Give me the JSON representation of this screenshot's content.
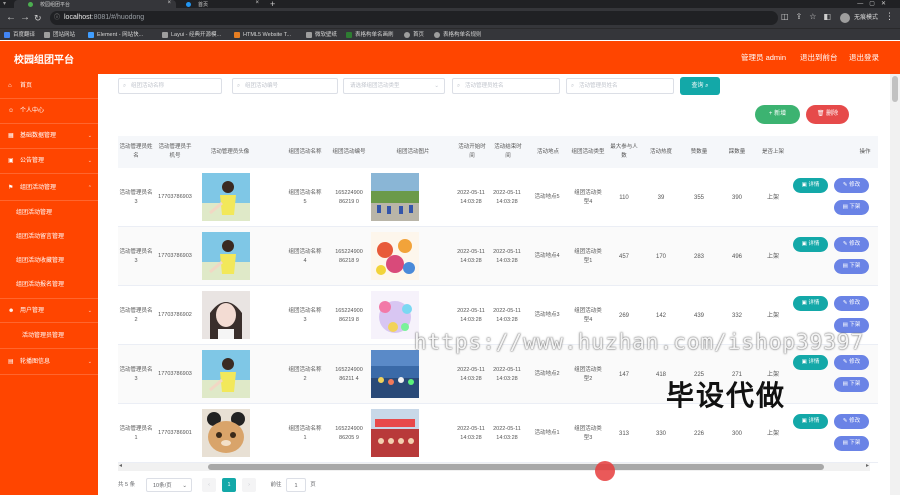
{
  "browser": {
    "tabs": [
      {
        "title": "校园组团平台"
      },
      {
        "title": "首页"
      }
    ],
    "new_tab": "+",
    "url_host": "localhost",
    "url_path": ":8081/#/huodong",
    "profile": "无痕模式",
    "bookmarks": [
      "百度翻译",
      "团站网站",
      "Element - 网站快...",
      "Layui - 经典开源模...",
      "HTML5 Website T...",
      "微软壁纸",
      "表格构单名画刷",
      "首页",
      "表格构单名规则"
    ]
  },
  "header": {
    "brand": "校园组团平台",
    "user": "管理员 admin",
    "exit_backend": "退出到前台",
    "logout": "退出登录"
  },
  "sidebar": {
    "items": [
      {
        "label": "首页",
        "icon": "home-icon"
      },
      {
        "label": "个人中心",
        "icon": "user-icon"
      },
      {
        "label": "基础数据管理",
        "icon": "grid-icon"
      },
      {
        "label": "公告管理",
        "icon": "notice-icon"
      },
      {
        "label": "组团活动管理",
        "icon": "flag-icon"
      }
    ],
    "subitems": [
      "组团活动管理",
      "组团活动留言管理",
      "组团活动收藏管理",
      "组团活动报名管理"
    ],
    "items2": [
      {
        "label": "用户管理",
        "icon": "users-icon"
      },
      {
        "label": "活动管理员管理",
        "icon": ""
      },
      {
        "label": "轮播图信息",
        "icon": "image-icon"
      }
    ]
  },
  "search": {
    "f1": "组团活动名称",
    "f2": "组团活动编号",
    "f3": "请选择组团活动类型",
    "f4": "活动管理员姓名",
    "f5": "活动管理员姓名",
    "query": "查询"
  },
  "toolbar": {
    "add": "+ 新增",
    "delete": "删除"
  },
  "table": {
    "headers": [
      "活动管理员姓名",
      "活动管理员手机号",
      "活动管理员头像",
      "组团活动名称",
      "组团活动编号",
      "组团活动图片",
      "活动开始时间",
      "活动结束时间",
      "活动地点",
      "组团活动类型",
      "最大参与人数",
      "活动热度",
      "赞数量",
      "踩数量",
      "是否上架",
      "操作"
    ],
    "rows": [
      {
        "name": "活动管理员名3",
        "phone": "17703786903",
        "title": "组团活动名称5",
        "code": "16522490086219 0",
        "start": "2022-05-11 14:03:28",
        "end": "2022-05-11 14:03:28",
        "place": "活动地点5",
        "type": "组团活动类型4",
        "max": "110",
        "hot": "39",
        "up": "355",
        "down": "390",
        "status": "上架"
      },
      {
        "name": "活动管理员名3",
        "phone": "17703786903",
        "title": "组团活动名称4",
        "code": "16522490086218 9",
        "start": "2022-05-11 14:03:28",
        "end": "2022-05-11 14:03:28",
        "place": "活动地点4",
        "type": "组团活动类型1",
        "max": "457",
        "hot": "170",
        "up": "283",
        "down": "496",
        "status": "上架"
      },
      {
        "name": "活动管理员名2",
        "phone": "17703786902",
        "title": "组团活动名称3",
        "code": "16522490086219 8",
        "start": "2022-05-11 14:03:28",
        "end": "2022-05-11 14:03:28",
        "place": "活动地点3",
        "type": "组团活动类型4",
        "max": "269",
        "hot": "142",
        "up": "439",
        "down": "332",
        "status": "上架"
      },
      {
        "name": "活动管理员名3",
        "phone": "17703786903",
        "title": "组团活动名称2",
        "code": "16522490086211 4",
        "start": "2022-05-11 14:03:28",
        "end": "2022-05-11 14:03:28",
        "place": "活动地点2",
        "type": "组团活动类型2",
        "max": "147",
        "hot": "418",
        "up": "225",
        "down": "271",
        "status": "上架"
      },
      {
        "name": "活动管理员名1",
        "phone": "17703786901",
        "title": "组团活动名称1",
        "code": "16522490086205 9",
        "start": "2022-05-11 14:03:28",
        "end": "2022-05-11 14:03:28",
        "place": "活动地点1",
        "type": "组团活动类型3",
        "max": "313",
        "hot": "330",
        "up": "226",
        "down": "300",
        "status": "上架"
      }
    ],
    "actions": {
      "detail": "详情",
      "edit": "修改",
      "off": "下架"
    }
  },
  "pagination": {
    "total": "共 5 条",
    "size": "10条/页",
    "page": "1",
    "goto": "前往",
    "goto_page": "1",
    "page_unit": "页"
  },
  "overlay": {
    "watermark": "https://www.huzhan.com/ishop39397",
    "stamp": "毕设代做"
  },
  "colors": {
    "brand": "#ff4500",
    "teal": "#13a8a8",
    "green": "#3cb371",
    "red": "#e64a4a",
    "blue": "#6a83e6"
  }
}
